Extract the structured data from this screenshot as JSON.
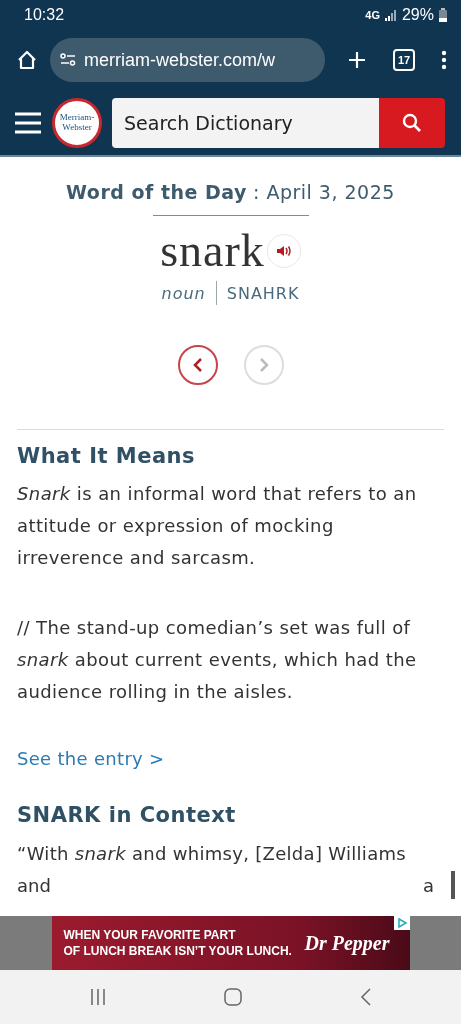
{
  "status_bar": {
    "time": "10:32",
    "network": "4G",
    "battery": "29%"
  },
  "browser": {
    "url": "merriam-webster.com/w",
    "tab_count": "17"
  },
  "header": {
    "logo": [
      "Merriam-",
      "Webster"
    ],
    "search": {
      "placeholder": "Search Dictionary"
    }
  },
  "word_of_day": {
    "label": "Word of the Day",
    "date": ": April 3, 2025",
    "word": "snark",
    "part_of_speech": "noun",
    "pronunciation": "SNAHRK",
    "nav": [
      {
        "kind": "prev",
        "disabled": false
      },
      {
        "kind": "next",
        "disabled": true
      }
    ]
  },
  "meaning": {
    "heading": "What It Means",
    "paragraphs": [
      "*Snark* is an informal word that refers to an attitude or expression of mocking irreverence and sarcasm.",
      "// The stand-up comedian’s set was full of *snark* about current events, which had the audience rolling in the aisles."
    ],
    "link": "See the entry >"
  },
  "context": {
    "heading": "SNARK in Context",
    "line_1": "“With *snark* and whimsy, [Zelda] Williams",
    "line_2_left": "and",
    "line_2_right": "a"
  },
  "ad": {
    "lines": [
      "WHEN YOUR FAVORITE PART",
      "OF LUNCH BREAK ISN’T YOUR LUNCH."
    ],
    "logo": "Dr Pepper"
  }
}
